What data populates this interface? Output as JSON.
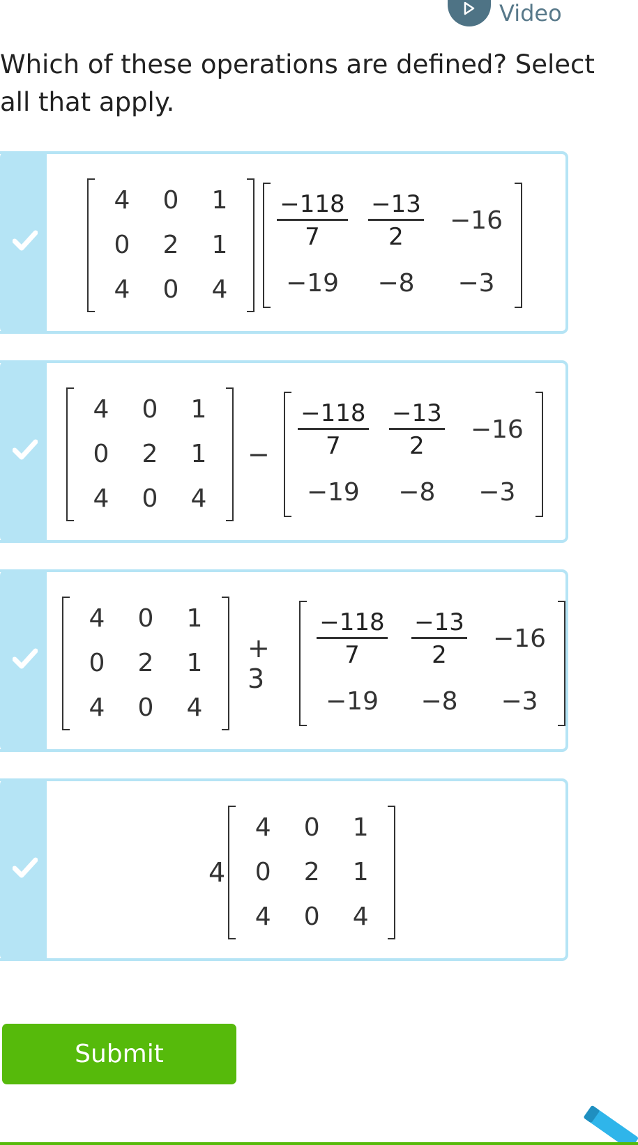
{
  "video": {
    "label": "Video",
    "icon": "play-icon"
  },
  "question": {
    "line1": "Which of these operations are defined? Select",
    "line2": "all that apply."
  },
  "matrixA": {
    "r1": [
      "4",
      "0",
      "1"
    ],
    "r2": [
      "0",
      "2",
      "1"
    ],
    "r3": [
      "4",
      "0",
      "4"
    ]
  },
  "matrixB": {
    "f1": {
      "num": "−118",
      "den": "7"
    },
    "f2": {
      "num": "−13",
      "den": "2"
    },
    "c3": "−16",
    "r2": [
      "−19",
      "−8",
      "−3"
    ]
  },
  "options": {
    "op2": "−",
    "op3_plus": "+ 3",
    "op4_scalar": "4"
  },
  "submit": {
    "label": "Submit"
  },
  "colors": {
    "tile": "#b5e4f5",
    "submit": "#56ba0b",
    "video": "#4e7385",
    "pencil": "#2fb5ea"
  }
}
